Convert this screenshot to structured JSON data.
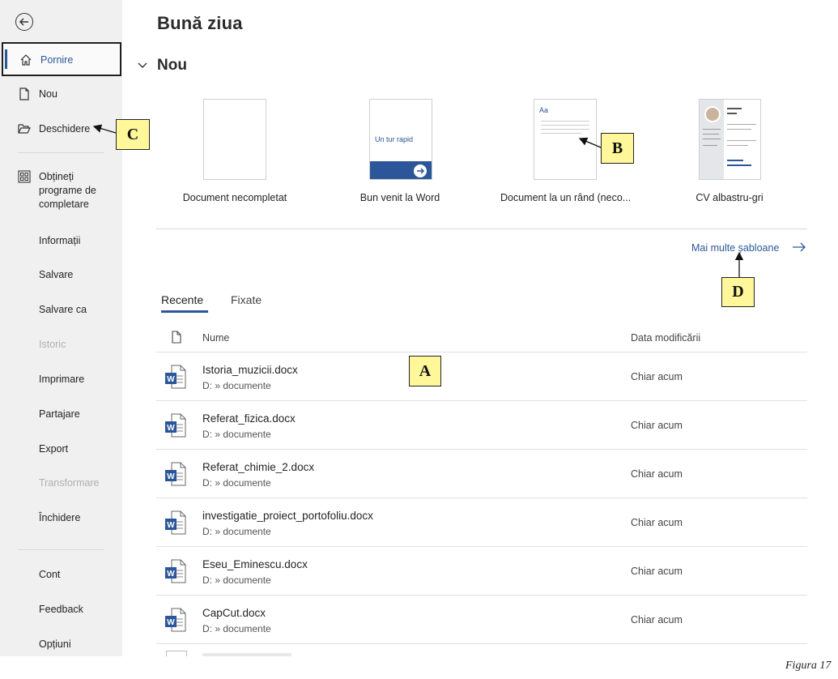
{
  "greeting": "Bună ziua",
  "sidebar": {
    "items": [
      {
        "label": "Pornire",
        "icon": "home-icon"
      },
      {
        "label": "Nou",
        "icon": "new-document-icon"
      },
      {
        "label": "Deschidere",
        "icon": "folder-open-icon"
      },
      {
        "label": "Obțineți programe de completare",
        "icon": "add-ins-icon"
      },
      {
        "label": "Informații"
      },
      {
        "label": "Salvare"
      },
      {
        "label": "Salvare ca"
      },
      {
        "label": "Istoric"
      },
      {
        "label": "Imprimare"
      },
      {
        "label": "Partajare"
      },
      {
        "label": "Export"
      },
      {
        "label": "Transformare"
      },
      {
        "label": "Închidere"
      },
      {
        "label": "Cont"
      },
      {
        "label": "Feedback"
      },
      {
        "label": "Opțiuni"
      }
    ]
  },
  "new_section": {
    "title": "Nou",
    "templates": [
      {
        "caption": "Document necompletat"
      },
      {
        "caption": "Bun venit la Word",
        "thumb_text": "Un tur rapid"
      },
      {
        "caption": "Document la un rând (neco...",
        "thumb_text": "Aa"
      },
      {
        "caption": "CV albastru-gri"
      }
    ],
    "more_templates": "Mai multe șabloane"
  },
  "tabs": [
    "Recente",
    "Fixate"
  ],
  "columns": {
    "name": "Nume",
    "date": "Data modificării"
  },
  "files": [
    {
      "name": "Istoria_muzicii.docx",
      "path": "D: » documente",
      "date": "Chiar acum"
    },
    {
      "name": "Referat_fizica.docx",
      "path": "D: » documente",
      "date": "Chiar acum"
    },
    {
      "name": "Referat_chimie_2.docx",
      "path": "D: » documente",
      "date": "Chiar acum"
    },
    {
      "name": "investigatie_proiect_portofoliu.docx",
      "path": "D: » documente",
      "date": "Chiar acum"
    },
    {
      "name": "Eseu_Eminescu.docx",
      "path": "D: » documente",
      "date": "Chiar acum"
    },
    {
      "name": "CapCut.docx",
      "path": "D: » documente",
      "date": "Chiar acum"
    }
  ],
  "callouts": {
    "a": "A",
    "b": "B",
    "c": "C",
    "d": "D"
  },
  "figure_caption": "Figura 17",
  "colors": {
    "accent": "#2b579a",
    "callout": "#fff799",
    "sidebar": "#f0f0f0"
  }
}
